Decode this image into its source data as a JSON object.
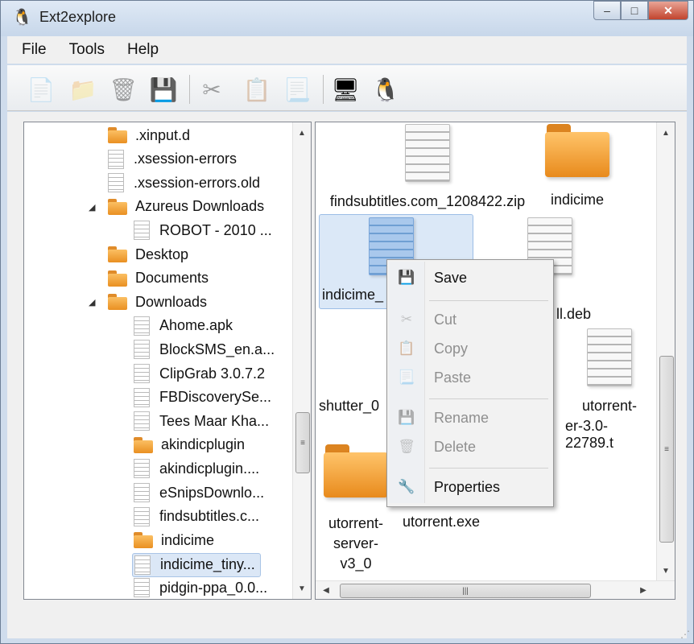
{
  "window": {
    "title": "Ext2explore"
  },
  "menu": [
    "File",
    "Tools",
    "Help"
  ],
  "toolbar": [
    {
      "icon": "new-file-icon",
      "enabled": false
    },
    {
      "icon": "folder-icon",
      "enabled": false
    },
    {
      "icon": "trash-icon",
      "enabled": false
    },
    {
      "icon": "save-icon",
      "enabled": true
    },
    {
      "icon": "cut-icon",
      "enabled": false
    },
    {
      "icon": "copy-icon",
      "enabled": false
    },
    {
      "icon": "paste-icon",
      "enabled": false
    },
    {
      "icon": "computer-icon",
      "enabled": true
    },
    {
      "icon": "linux-tux-icon",
      "enabled": true
    }
  ],
  "tree": [
    {
      "label": ".xinput.d",
      "type": "folder",
      "level": 0
    },
    {
      "label": ".xsession-errors",
      "type": "file",
      "level": 0
    },
    {
      "label": ".xsession-errors.old",
      "type": "file",
      "level": 0
    },
    {
      "label": "Azureus Downloads",
      "type": "folder",
      "level": 0,
      "expanded": true
    },
    {
      "label": "ROBOT - 2010 ...",
      "type": "file",
      "level": 1
    },
    {
      "label": "Desktop",
      "type": "folder",
      "level": 0
    },
    {
      "label": "Documents",
      "type": "folder",
      "level": 0
    },
    {
      "label": "Downloads",
      "type": "folder",
      "level": 0,
      "expanded": true
    },
    {
      "label": "Ahome.apk",
      "type": "file",
      "level": 1
    },
    {
      "label": "BlockSMS_en.a...",
      "type": "file",
      "level": 1
    },
    {
      "label": "ClipGrab 3.0.7.2",
      "type": "file",
      "level": 1
    },
    {
      "label": "FBDiscoverySe...",
      "type": "file",
      "level": 1
    },
    {
      "label": "Tees Maar Kha...",
      "type": "file",
      "level": 1
    },
    {
      "label": "akindicplugin",
      "type": "folder",
      "level": 1
    },
    {
      "label": "akindicplugin....",
      "type": "file",
      "level": 1
    },
    {
      "label": "eSnipsDownlo...",
      "type": "file",
      "level": 1
    },
    {
      "label": "findsubtitles.c...",
      "type": "file",
      "level": 1
    },
    {
      "label": "indicime",
      "type": "folder",
      "level": 1
    },
    {
      "label": "indicime_tiny...",
      "type": "file",
      "level": 1,
      "selected": true
    },
    {
      "label": "pidgin-ppa_0.0...",
      "type": "file",
      "level": 1
    }
  ],
  "files": [
    {
      "label": "findsubtitles.com_1208422.zip",
      "type": "file"
    },
    {
      "label": "indicime",
      "type": "folder"
    },
    {
      "label": "indicime_",
      "type": "file",
      "selected": true
    },
    {
      "label": "ll.deb",
      "type": "file"
    },
    {
      "label": "shutter_0",
      "type": "file"
    },
    {
      "label": "utorrent-",
      "label2": "er-3.0-22789.t",
      "type": "file"
    },
    {
      "label": "utorrent-",
      "label2": "server-",
      "label3": "v3_0",
      "type": "folder"
    },
    {
      "label": "utorrent.exe",
      "type": "file"
    }
  ],
  "context_menu": [
    {
      "label": "Save",
      "icon": "save-icon",
      "enabled": true
    },
    {
      "label": "Cut",
      "icon": "cut-icon",
      "enabled": false
    },
    {
      "label": "Copy",
      "icon": "copy-icon",
      "enabled": false
    },
    {
      "label": "Paste",
      "icon": "paste-icon",
      "enabled": false
    },
    {
      "label": "Rename",
      "icon": "rename-icon",
      "enabled": false
    },
    {
      "label": "Delete",
      "icon": "delete-icon",
      "enabled": false
    },
    {
      "label": "Properties",
      "icon": "properties-icon",
      "enabled": true
    }
  ],
  "window_controls": {
    "minimize": "–",
    "maximize": "□",
    "close": "✕"
  },
  "scroll_glyphs": {
    "up": "▲",
    "down": "▼",
    "left": "◀",
    "right": "▶",
    "grip": "≡",
    "hgrip": "|||"
  }
}
